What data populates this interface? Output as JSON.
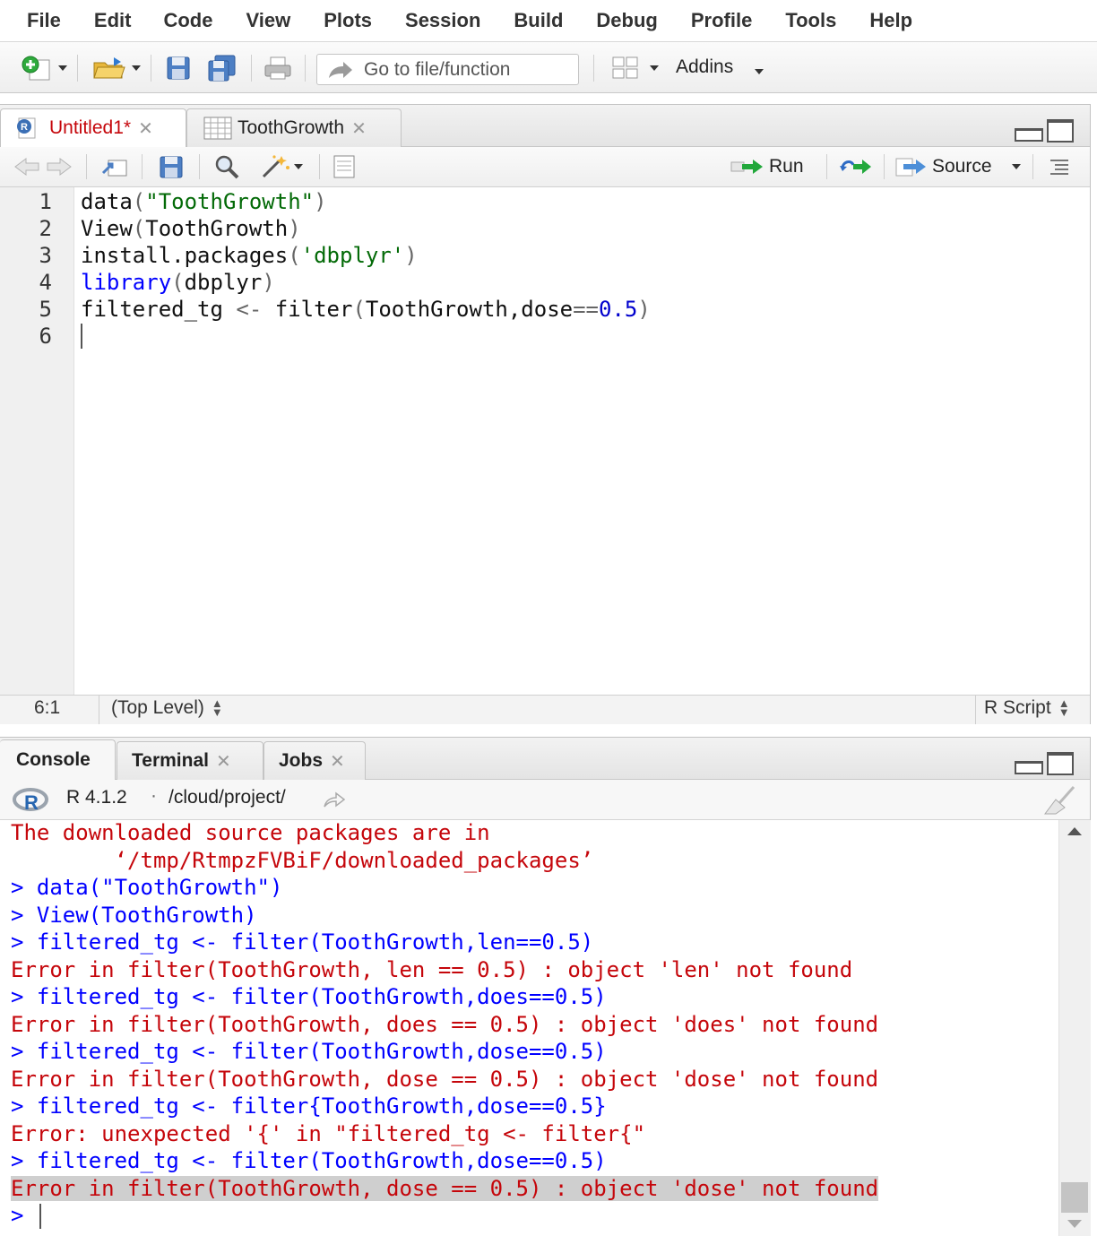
{
  "menu": [
    "File",
    "Edit",
    "Code",
    "View",
    "Plots",
    "Session",
    "Build",
    "Debug",
    "Profile",
    "Tools",
    "Help"
  ],
  "toolbar": {
    "goto_placeholder": "Go to file/function",
    "addins_label": "Addins"
  },
  "editor": {
    "tabs": [
      {
        "label": "Untitled1*",
        "color": "#c5060b"
      },
      {
        "label": "ToothGrowth",
        "color": "#222222"
      }
    ],
    "run_label": "Run",
    "source_label": "Source",
    "line_numbers": [
      "1",
      "2",
      "3",
      "4",
      "5",
      "6"
    ],
    "status": {
      "position": "6:1",
      "scope": "(Top Level)",
      "filetype": "R Script"
    }
  },
  "console": {
    "tabs": [
      "Console",
      "Terminal",
      "Jobs"
    ],
    "r_version": "R 4.1.2",
    "path": "/cloud/project/",
    "prompt": ">"
  },
  "colors": {
    "error": "#c5060b",
    "command": "#0000ff",
    "string": "#036a07",
    "keyword": "#0000ff"
  }
}
